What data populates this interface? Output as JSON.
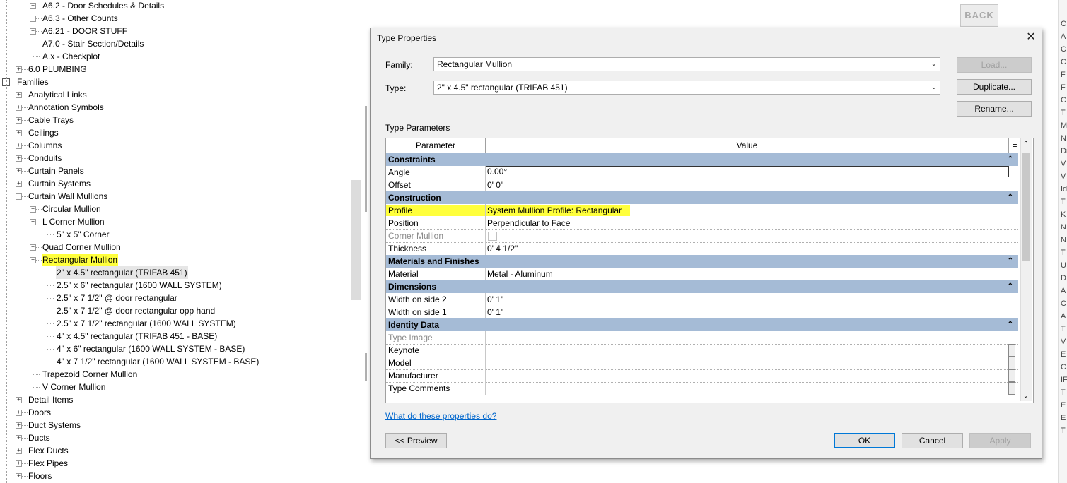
{
  "tree": {
    "items": [
      {
        "label": "A6.2 - Door Schedules & Details",
        "level": 2,
        "exp": "+"
      },
      {
        "label": "A6.3 - Other Counts",
        "level": 2,
        "exp": "+"
      },
      {
        "label": "A6.21 - DOOR STUFF",
        "level": 2,
        "exp": "+"
      },
      {
        "label": "A7.0 - Stair Section/Details",
        "level": 2,
        "exp": ""
      },
      {
        "label": "A.x - Checkplot",
        "level": 2,
        "exp": ""
      },
      {
        "label": "6.0 PLUMBING",
        "level": 1,
        "exp": "+"
      },
      {
        "label": "Families",
        "level": 0,
        "exp": "",
        "icon": true
      },
      {
        "label": "Analytical Links",
        "level": 1,
        "exp": "+"
      },
      {
        "label": "Annotation Symbols",
        "level": 1,
        "exp": "+"
      },
      {
        "label": "Cable Trays",
        "level": 1,
        "exp": "+"
      },
      {
        "label": "Ceilings",
        "level": 1,
        "exp": "+"
      },
      {
        "label": "Columns",
        "level": 1,
        "exp": "+"
      },
      {
        "label": "Conduits",
        "level": 1,
        "exp": "+"
      },
      {
        "label": "Curtain Panels",
        "level": 1,
        "exp": "+"
      },
      {
        "label": "Curtain Systems",
        "level": 1,
        "exp": "+"
      },
      {
        "label": "Curtain Wall Mullions",
        "level": 1,
        "exp": "-"
      },
      {
        "label": "Circular Mullion",
        "level": 2,
        "exp": "+"
      },
      {
        "label": "L Corner Mullion",
        "level": 2,
        "exp": "-"
      },
      {
        "label": "5\" x 5\" Corner",
        "level": 3,
        "exp": ""
      },
      {
        "label": "Quad Corner Mullion",
        "level": 2,
        "exp": "+"
      },
      {
        "label": "Rectangular Mullion",
        "level": 2,
        "exp": "-",
        "highlight": true
      },
      {
        "label": "2\" x 4.5\" rectangular (TRIFAB 451)",
        "level": 3,
        "exp": "",
        "selected": true
      },
      {
        "label": "2.5\" x 6\" rectangular (1600 WALL SYSTEM)",
        "level": 3,
        "exp": ""
      },
      {
        "label": "2.5\" x 7 1/2\" @ door rectangular",
        "level": 3,
        "exp": ""
      },
      {
        "label": "2.5\" x 7 1/2\" @ door rectangular opp hand",
        "level": 3,
        "exp": ""
      },
      {
        "label": "2.5\" x 7 1/2\" rectangular (1600 WALL SYSTEM)",
        "level": 3,
        "exp": ""
      },
      {
        "label": "4\" x 4.5\" rectangular (TRIFAB 451 - BASE)",
        "level": 3,
        "exp": ""
      },
      {
        "label": "4\" x 6\" rectangular (1600 WALL SYSTEM - BASE)",
        "level": 3,
        "exp": ""
      },
      {
        "label": "4\" x 7 1/2\" rectangular (1600 WALL SYSTEM - BASE)",
        "level": 3,
        "exp": ""
      },
      {
        "label": "Trapezoid Corner Mullion",
        "level": 2,
        "exp": ""
      },
      {
        "label": "V Corner Mullion",
        "level": 2,
        "exp": ""
      },
      {
        "label": "Detail Items",
        "level": 1,
        "exp": "+"
      },
      {
        "label": "Doors",
        "level": 1,
        "exp": "+"
      },
      {
        "label": "Duct Systems",
        "level": 1,
        "exp": "+"
      },
      {
        "label": "Ducts",
        "level": 1,
        "exp": "+"
      },
      {
        "label": "Flex Ducts",
        "level": 1,
        "exp": "+"
      },
      {
        "label": "Flex Pipes",
        "level": 1,
        "exp": "+"
      },
      {
        "label": "Floors",
        "level": 1,
        "exp": "+"
      }
    ]
  },
  "canvas": {
    "back_label": "BACK"
  },
  "right_panel": [
    "C",
    "A",
    "C",
    "C",
    "F",
    "F",
    "C",
    "T",
    "M",
    "N",
    "Di",
    "V",
    "V",
    "Id",
    "T",
    "K",
    "N",
    "N",
    "T",
    "U",
    "D",
    "A",
    "C",
    "A",
    "T",
    "V",
    "E",
    "C",
    "IF",
    "T",
    "E",
    "E",
    "T"
  ],
  "dialog": {
    "title": "Type Properties",
    "close": "✕",
    "family_label": "Family:",
    "family_value": "Rectangular Mullion",
    "type_label": "Type:",
    "type_value": "2\" x 4.5\" rectangular (TRIFAB 451)",
    "load_label": "Load...",
    "duplicate_label": "Duplicate...",
    "rename_label": "Rename...",
    "type_params_label": "Type Parameters",
    "col_parameter": "Parameter",
    "col_value": "Value",
    "col_eq": "=",
    "help_link": "What do these properties do?",
    "preview_label": "<< Preview",
    "ok_label": "OK",
    "cancel_label": "Cancel",
    "apply_label": "Apply",
    "highlight_color": "#ffff3c",
    "group_color": "#a5bbd6"
  },
  "grid": {
    "groups": [
      {
        "name": "Constraints",
        "rows": [
          {
            "p": "Angle",
            "v": "0.00°",
            "edit": true
          },
          {
            "p": "Offset",
            "v": "0'  0\""
          }
        ]
      },
      {
        "name": "Construction",
        "rows": [
          {
            "p": "Profile",
            "v": "System Mullion Profile: Rectangular",
            "highlight": true
          },
          {
            "p": "Position",
            "v": "Perpendicular to Face"
          },
          {
            "p": "Corner Mullion",
            "v": "",
            "dim": true,
            "checkbox": true
          },
          {
            "p": "Thickness",
            "v": "0'  4 1/2\""
          }
        ]
      },
      {
        "name": "Materials and Finishes",
        "rows": [
          {
            "p": "Material",
            "v": "Metal - Aluminum"
          }
        ]
      },
      {
        "name": "Dimensions",
        "rows": [
          {
            "p": "Width on side 2",
            "v": "0'  1\""
          },
          {
            "p": "Width on side 1",
            "v": "0'  1\""
          }
        ]
      },
      {
        "name": "Identity Data",
        "rows": [
          {
            "p": "Type Image",
            "v": "",
            "dim": true
          },
          {
            "p": "Keynote",
            "v": "",
            "mini": true
          },
          {
            "p": "Model",
            "v": "",
            "mini": true
          },
          {
            "p": "Manufacturer",
            "v": "",
            "mini": true
          },
          {
            "p": "Type Comments",
            "v": "",
            "mini": true
          }
        ]
      }
    ],
    "collapse_glyph": "⌃"
  }
}
